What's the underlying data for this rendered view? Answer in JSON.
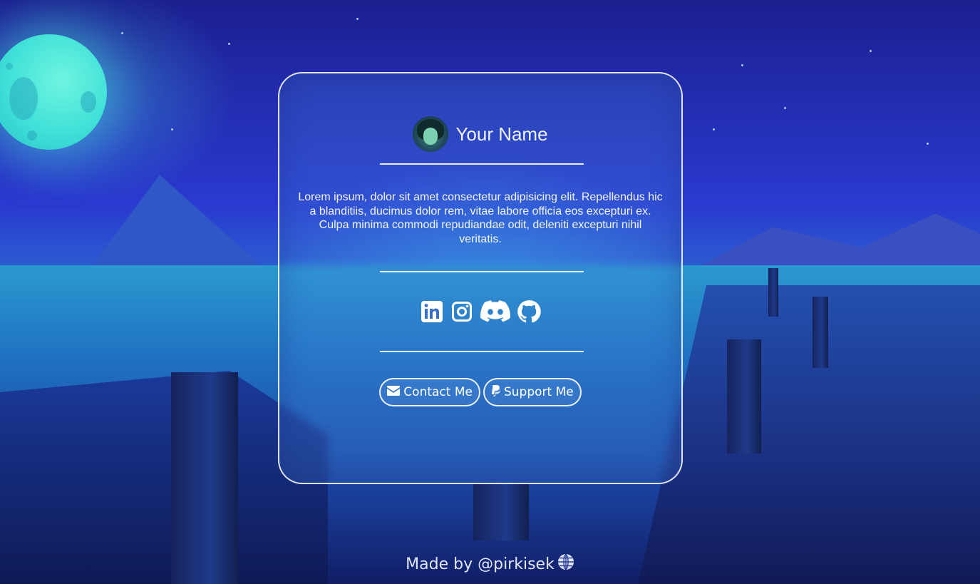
{
  "profile": {
    "name": "Your Name",
    "avatar_icon": "avatar-portrait",
    "bio": "Lorem ipsum, dolor sit amet consectetur adipisicing elit. Repellendus hic a blanditiis, ducimus dolor rem, vitae labore officia eos excepturi ex. Culpa minima commodi repudiandae odit, deleniti excepturi nihil veritatis."
  },
  "socials": [
    {
      "name": "linkedin",
      "icon": "linkedin-icon"
    },
    {
      "name": "instagram",
      "icon": "instagram-icon"
    },
    {
      "name": "discord",
      "icon": "discord-icon"
    },
    {
      "name": "github",
      "icon": "github-icon"
    }
  ],
  "buttons": {
    "contact_label": "Contact Me",
    "contact_icon": "envelope-icon",
    "support_label": "Support Me",
    "support_icon": "paypal-icon"
  },
  "footer": {
    "text": "Made by @pirkisek",
    "icon": "globe-icon"
  },
  "colors": {
    "card_border": "#ffffff",
    "text": "#f2f5ff",
    "moon": "#3fe0d8",
    "sky": "#2a3ad0"
  }
}
